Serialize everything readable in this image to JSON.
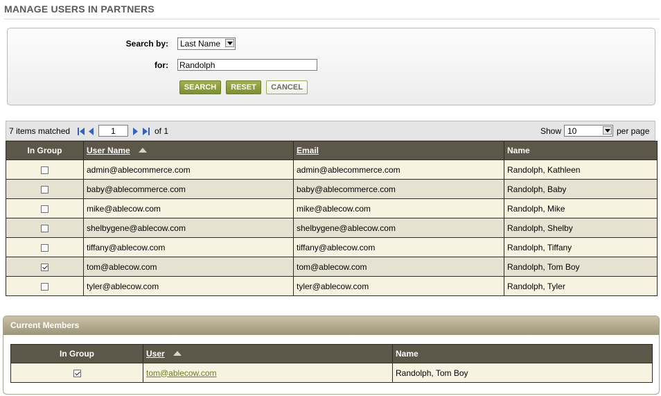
{
  "page": {
    "title": "MANAGE USERS IN PARTNERS"
  },
  "search": {
    "search_by_label": "Search by:",
    "search_by_value": "Last Name",
    "for_label": "for:",
    "for_value": "Randolph",
    "buttons": {
      "search": "SEARCH",
      "reset": "RESET",
      "cancel": "CANCEL"
    }
  },
  "pager": {
    "matched_text": "7 items matched",
    "current_page": "1",
    "of_text": "of 1",
    "show_label": "Show",
    "page_size": "10",
    "per_page_label": "per page"
  },
  "users_table": {
    "columns": {
      "in_group": "In Group",
      "user_name": "User Name",
      "email": "Email",
      "name": "Name"
    },
    "rows": [
      {
        "checked": false,
        "user_name": "admin@ablecommerce.com",
        "email": "admin@ablecommerce.com",
        "name": "Randolph, Kathleen"
      },
      {
        "checked": false,
        "user_name": "baby@ablecommerce.com",
        "email": "baby@ablecommerce.com",
        "name": "Randolph, Baby"
      },
      {
        "checked": false,
        "user_name": "mike@ablecow.com",
        "email": "mike@ablecow.com",
        "name": "Randolph, Mike"
      },
      {
        "checked": false,
        "user_name": "shelbygene@ablecow.com",
        "email": "shelbygene@ablecow.com",
        "name": "Randolph, Shelby"
      },
      {
        "checked": false,
        "user_name": "tiffany@ablecow.com",
        "email": "tiffany@ablecow.com",
        "name": "Randolph, Tiffany"
      },
      {
        "checked": true,
        "user_name": "tom@ablecow.com",
        "email": "tom@ablecow.com",
        "name": "Randolph, Tom Boy"
      },
      {
        "checked": false,
        "user_name": "tyler@ablecow.com",
        "email": "tyler@ablecow.com",
        "name": "Randolph, Tyler"
      }
    ]
  },
  "members": {
    "title": "Current Members",
    "columns": {
      "in_group": "In Group",
      "user": "User",
      "name": "Name"
    },
    "rows": [
      {
        "checked": true,
        "user": "tom@ablecow.com",
        "name": "Randolph, Tom Boy"
      }
    ]
  },
  "colors": {
    "header_bg": "#5c5748",
    "row_odd": "#f7f3e1",
    "row_even": "#e6e2d2",
    "button_green": "#8fa03e",
    "link_green": "#6b7e17",
    "pager_icon_blue": "#2f63c8"
  },
  "icons": [
    "first-page-icon",
    "prev-page-icon",
    "next-page-icon",
    "last-page-icon",
    "dropdown-arrow-icon",
    "sort-ascending-icon",
    "checkbox-icon"
  ]
}
